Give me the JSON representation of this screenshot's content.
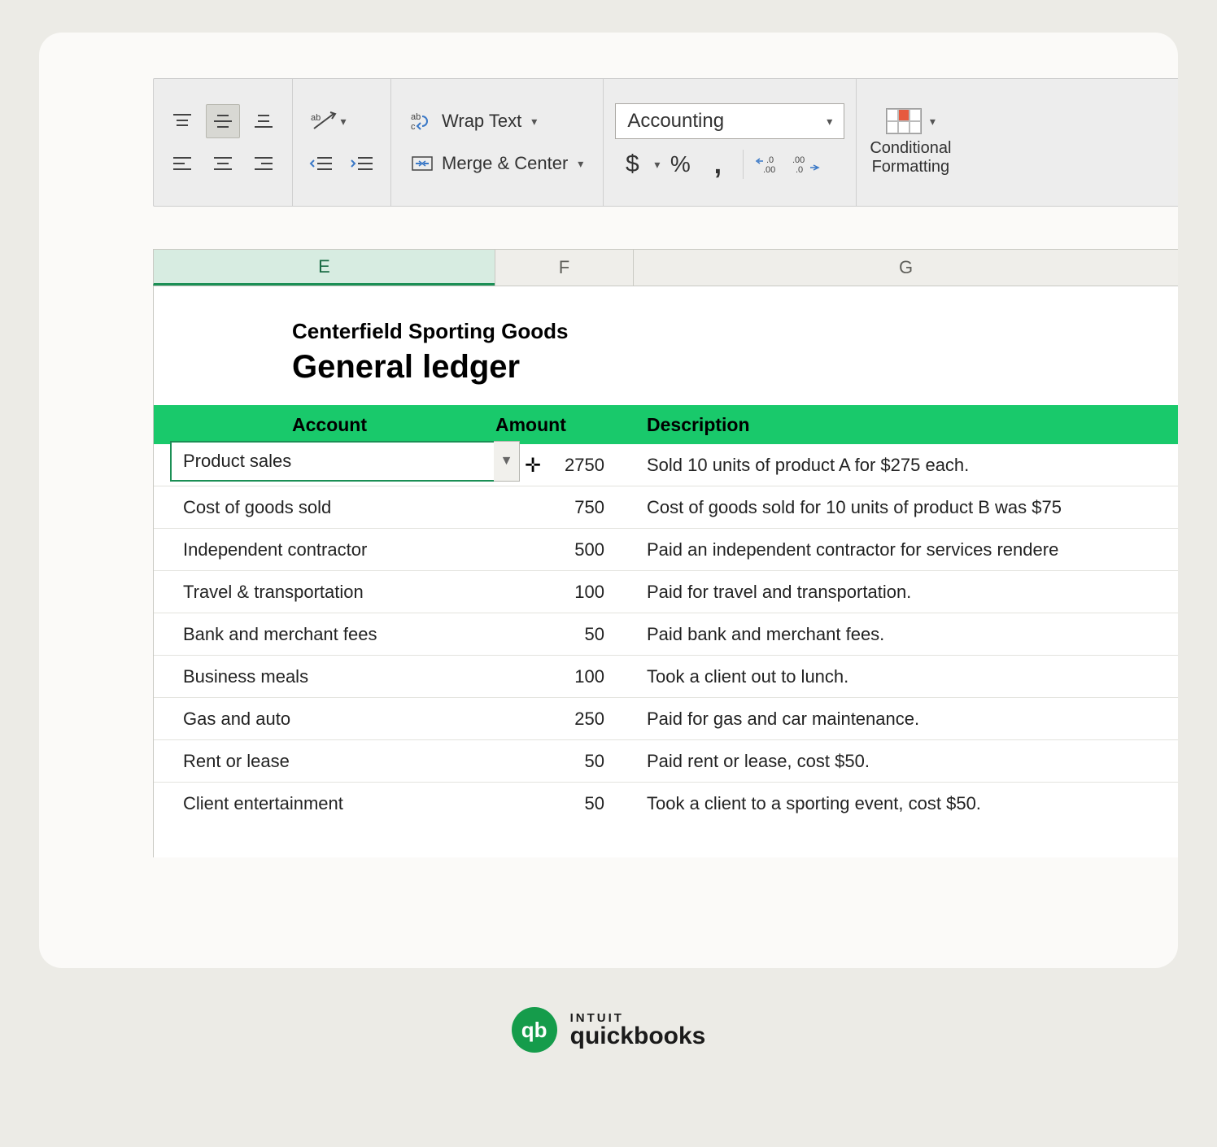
{
  "ribbon": {
    "wrap_text": "Wrap Text",
    "merge_center": "Merge & Center",
    "format_selected": "Accounting",
    "conditional_formatting": "Conditional\nFormatting"
  },
  "columns": [
    "E",
    "F",
    "G"
  ],
  "selected_column_index": 0,
  "company_name": "Centerfield Sporting Goods",
  "report_title": "General ledger",
  "headers": {
    "account": "Account",
    "amount": "Amount",
    "description": "Description"
  },
  "rows": [
    {
      "account": "Product sales",
      "amount": "2750",
      "description": "Sold 10 units of product A for $275 each."
    },
    {
      "account": "Cost of goods sold",
      "amount": "750",
      "description": "Cost of goods sold for 10 units of product B was $75"
    },
    {
      "account": "Independent contractor",
      "amount": "500",
      "description": "Paid an independent contractor for services rendere"
    },
    {
      "account": "Travel & transportation",
      "amount": "100",
      "description": "Paid for travel and transportation."
    },
    {
      "account": "Bank and merchant fees",
      "amount": "50",
      "description": "Paid bank and merchant fees."
    },
    {
      "account": "Business meals",
      "amount": "100",
      "description": "Took a client out to lunch."
    },
    {
      "account": "Gas and auto",
      "amount": "250",
      "description": "Paid for gas and car maintenance."
    },
    {
      "account": "Rent or lease",
      "amount": "50",
      "description": "Paid rent or lease, cost $50."
    },
    {
      "account": "Client entertainment",
      "amount": "50",
      "description": "Took a client to a sporting event, cost $50."
    }
  ],
  "selected_cell_value": "Product sales",
  "brand": {
    "intuit": "INTUIT",
    "qb": "quickbooks",
    "badge": "qb"
  },
  "colors": {
    "accent": "#19c96b",
    "select": "#1b8f55"
  }
}
